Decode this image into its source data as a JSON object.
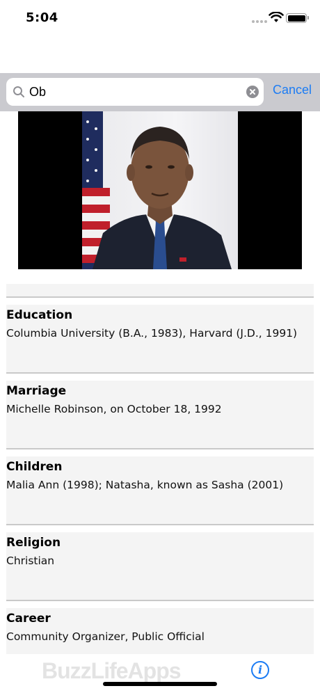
{
  "status_bar": {
    "time": "5:04",
    "icons": [
      "cellular-dots-icon",
      "wifi-icon",
      "battery-icon"
    ]
  },
  "search": {
    "value": "Ob",
    "placeholder": "",
    "cancel_label": "Cancel",
    "icons": [
      "search-icon",
      "clear-icon"
    ]
  },
  "photo": {
    "description_icon": "portrait-photo"
  },
  "details": [
    {
      "title": "Education",
      "value": "Columbia University (B.A., 1983), Harvard (J.D., 1991)"
    },
    {
      "title": "Marriage",
      "value": "Michelle Robinson, on October 18, 1992"
    },
    {
      "title": "Children",
      "value": "Malia Ann (1998); Natasha, known as Sasha (2001)"
    },
    {
      "title": "Religion",
      "value": "Christian"
    },
    {
      "title": "Career",
      "value": "Community Organizer, Public Official"
    }
  ],
  "footer": {
    "watermark": "BuzzLifeApps",
    "info_icon_glyph": "i"
  },
  "colors": {
    "accent": "#1c7cf4",
    "search_bar_bg": "#cacacf",
    "row_bg": "#f4f4f4",
    "divider": "#c9c9c9"
  }
}
